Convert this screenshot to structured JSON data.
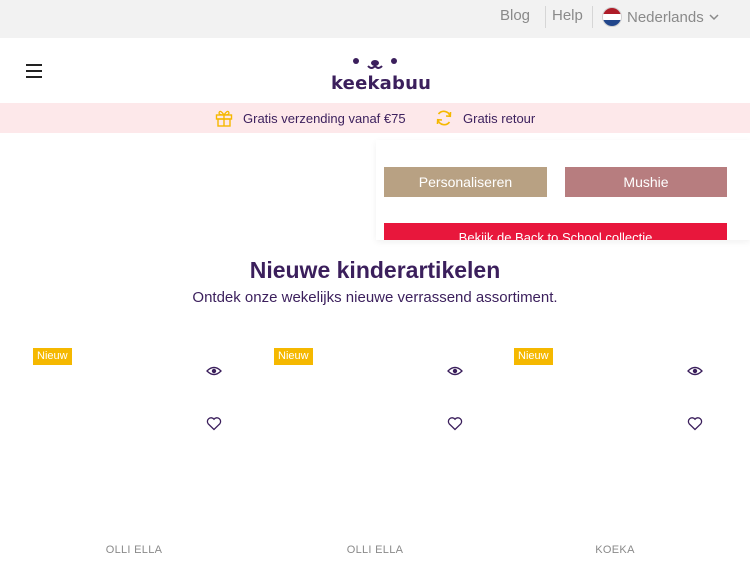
{
  "topbar": {
    "blog_label": "Blog",
    "help_label": "Help",
    "language_label": "Nederlands",
    "flag_icon": "netherlands-flag-icon",
    "chevron_icon": "chevron-down-icon"
  },
  "header": {
    "menu_icon": "hamburger-menu-icon",
    "logo_text": "keekabuu"
  },
  "promo": {
    "shipping_text": "Gratis verzending vanaf €75",
    "shipping_icon": "gift-icon",
    "returns_text": "Gratis retour",
    "returns_icon": "refresh-icon"
  },
  "panel": {
    "personaliseren_label": "Personaliseren",
    "mushie_label": "Mushie",
    "back_to_school_label": "Bekijk de Back to School collectie"
  },
  "section": {
    "title": "Nieuwe kinderartikelen",
    "subtitle": "Ontdek onze wekelijks nieuwe verrassend assortiment."
  },
  "products": [
    {
      "badge": "Nieuw",
      "brand": "OLLI ELLA"
    },
    {
      "badge": "Nieuw",
      "brand": "OLLI ELLA"
    },
    {
      "badge": "Nieuw",
      "brand": "KOEKA"
    }
  ],
  "colors": {
    "brand_purple": "#3b1f5c",
    "promo_bg": "#fde8ea",
    "badge_yellow": "#f5b800",
    "personaliseren_bg": "#b8a183",
    "mushie_bg": "#b77d7f",
    "back_to_school_bg": "#e8173c"
  }
}
